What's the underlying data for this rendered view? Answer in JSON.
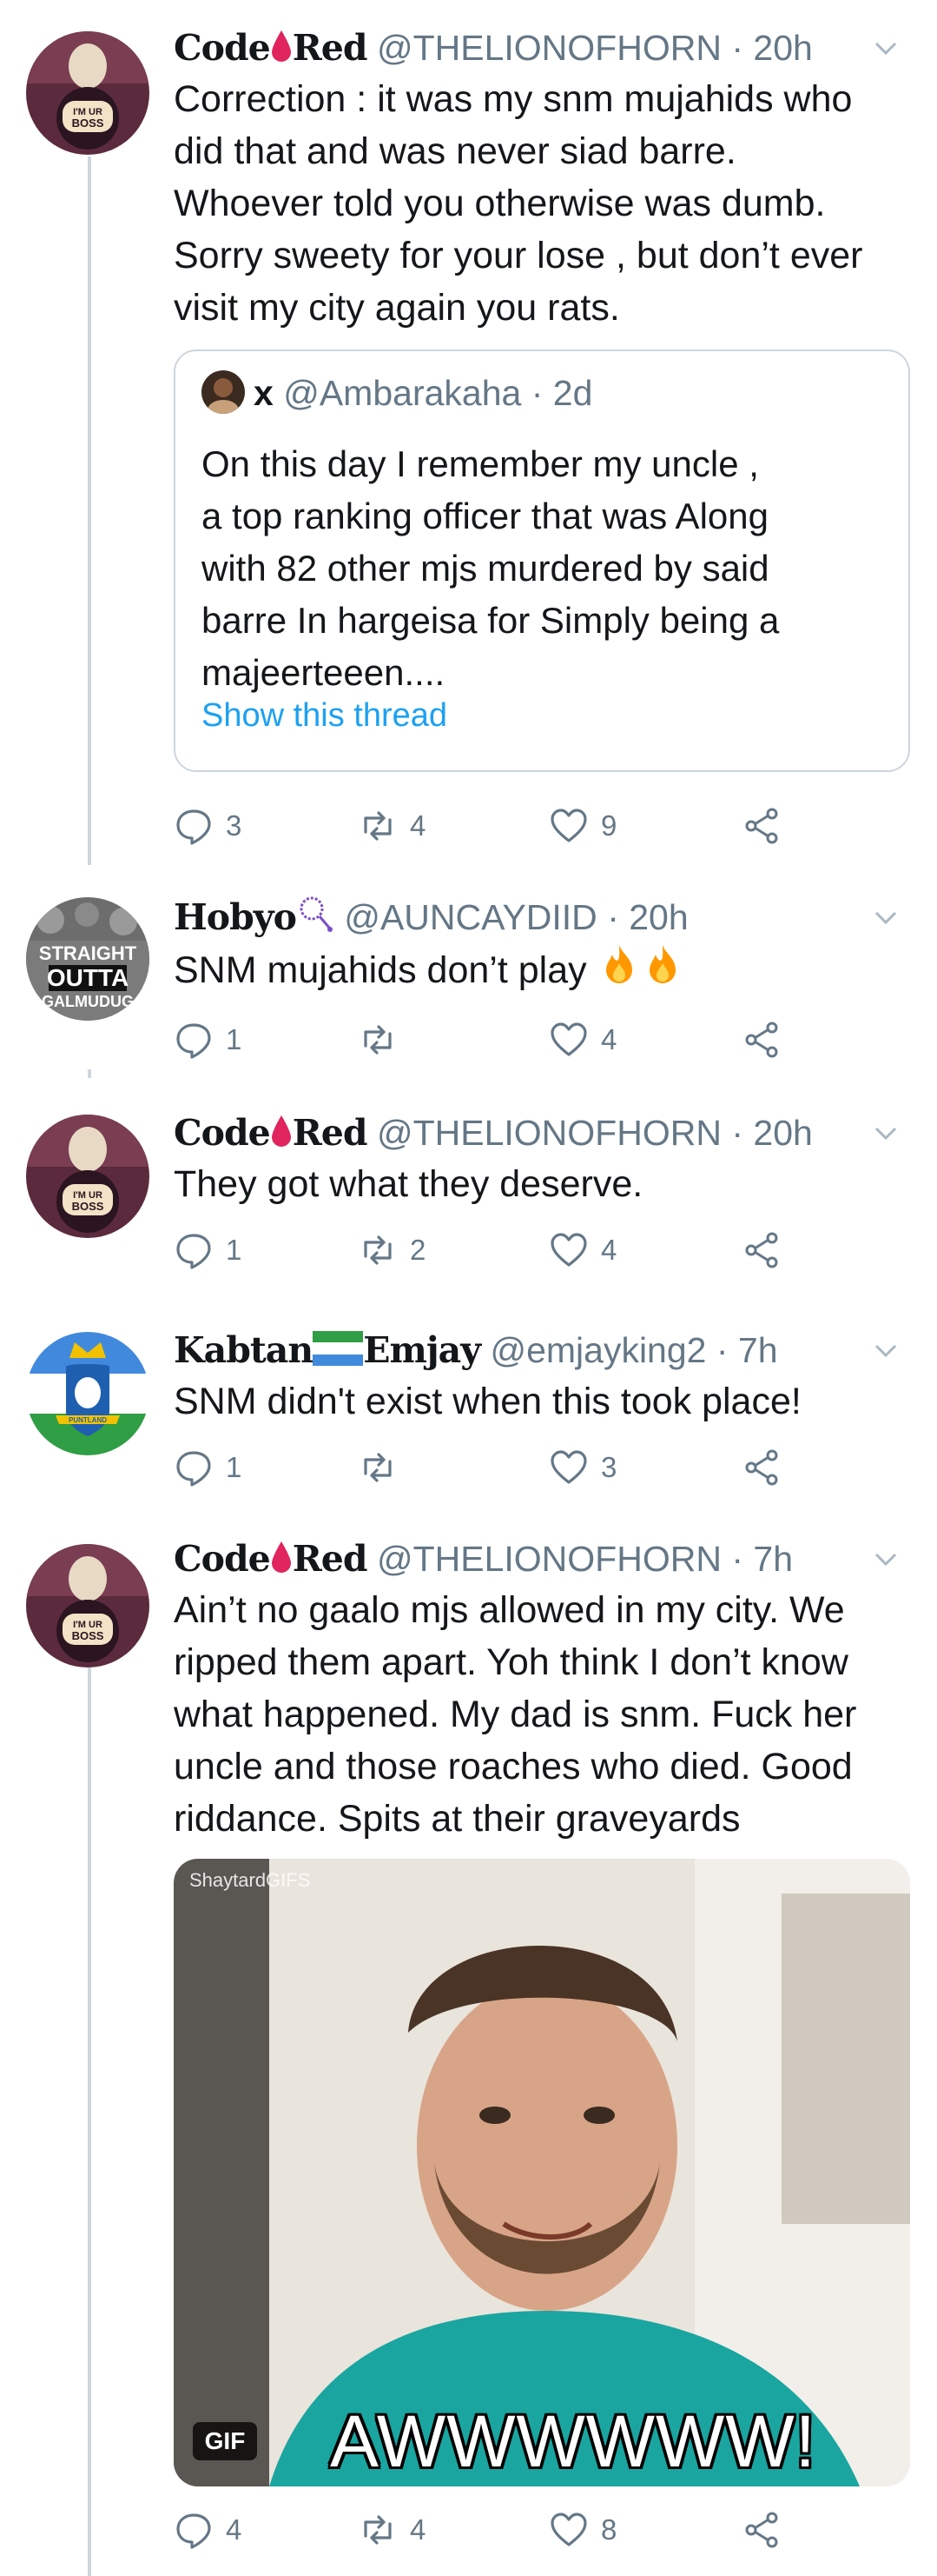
{
  "tweets": [
    {
      "name_a": "Code",
      "name_b": "Red",
      "name_emoji": "drop-of-blood-icon",
      "handle": "@THELIONOFHORN",
      "time": "· 20h",
      "text": "Correction : it was my snm mujahids who\ndid that and was never siad barre.\nWhoever told you otherwise was dumb.\nSorry sweety for your lose , but don’t ever\nvisit my city again you rats.",
      "replies": "3",
      "retweets": "4",
      "likes": "9"
    },
    {
      "name_a": "Hobyo",
      "name_emoji": "prayer-beads-icon",
      "handle": "@AUNCAYDIID",
      "time": "· 20h",
      "text": "SNM mujahids don’t play",
      "avatar_text": [
        "STRAIGHT",
        "OUTTA",
        "GALMUDUG"
      ],
      "replies": "1",
      "retweets": "",
      "likes": "4"
    },
    {
      "name_a": "Code",
      "name_b": "Red",
      "name_emoji": "drop-of-blood-icon",
      "handle": "@THELIONOFHORN",
      "time": "· 20h",
      "text": "They got what they deserve.",
      "replies": "1",
      "retweets": "2",
      "likes": "4"
    },
    {
      "name_a": "Kabtan",
      "name_b": "Emjay",
      "name_emoji": "flag-icon",
      "handle": "@emjayking2",
      "time": "· 7h",
      "text": "SNM didn't exist when this took place!",
      "replies": "1",
      "retweets": "",
      "likes": "3"
    },
    {
      "name_a": "Code",
      "name_b": "Red",
      "name_emoji": "drop-of-blood-icon",
      "handle": "@THELIONOFHORN",
      "time": "· 7h",
      "text": "Ain’t no gaalo mjs allowed in my city. We\nripped them apart. Yoh think I don’t know\nwhat happened. My dad is snm. Fuck her\nuncle and those roaches who died. Good\nriddance. Spits at their graveyards",
      "replies": "4",
      "retweets": "4",
      "likes": "8"
    }
  ],
  "quote": {
    "name": "x",
    "handle": "@Ambarakaha",
    "time": "· 2d",
    "text": "On this day I remember my uncle ,\na top ranking officer that was Along\nwith 82 other mjs murdered by said\nbarre In hargeisa for Simply being a\nmajeerteeen....",
    "show_thread": "Show this thread"
  },
  "gif": {
    "watermark": "ShaytardGIFS",
    "badge": "GIF",
    "caption": "AWWWWWW!"
  },
  "avatar_badge": "I'M UR BOSS",
  "kabtan_avatar_text": "PUNTLAND",
  "colors": {
    "text": "#14171a",
    "meta": "#657786",
    "link": "#1da1f2",
    "border": "#ccd6dd",
    "blood": "#e0245e",
    "fire": "#ff9800"
  },
  "icons": [
    "reply-icon",
    "retweet-icon",
    "like-icon",
    "share-icon",
    "chevron-down-icon",
    "fire-icon"
  ]
}
